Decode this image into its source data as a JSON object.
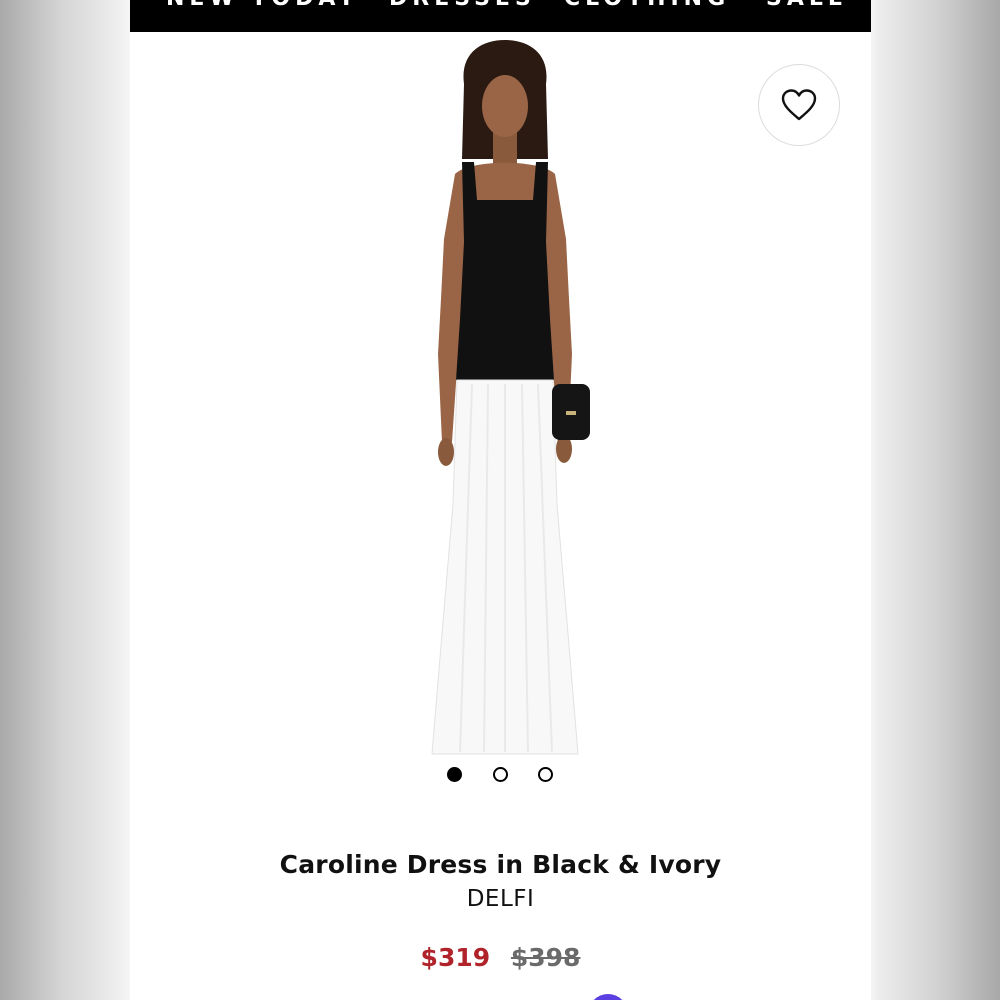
{
  "nav": {
    "items": [
      "NEW TODAY",
      "DRESSES",
      "CLOTHING",
      "SALE"
    ]
  },
  "product": {
    "title": "Caroline Dress in Black & Ivory",
    "brand": "DELFI",
    "sale_price": "$319",
    "original_price": "$398",
    "image_count": 3,
    "active_image": 1
  },
  "icons": {
    "favorite": "heart-outline-icon",
    "chat": "chat-icon"
  },
  "colors": {
    "nav_bg": "#000000",
    "sale_price": "#b0232a",
    "original_price": "#6a6a6a",
    "chat_accent": "#5b3fe0",
    "top_garment": "#111111",
    "skirt_garment": "#ffffff"
  }
}
